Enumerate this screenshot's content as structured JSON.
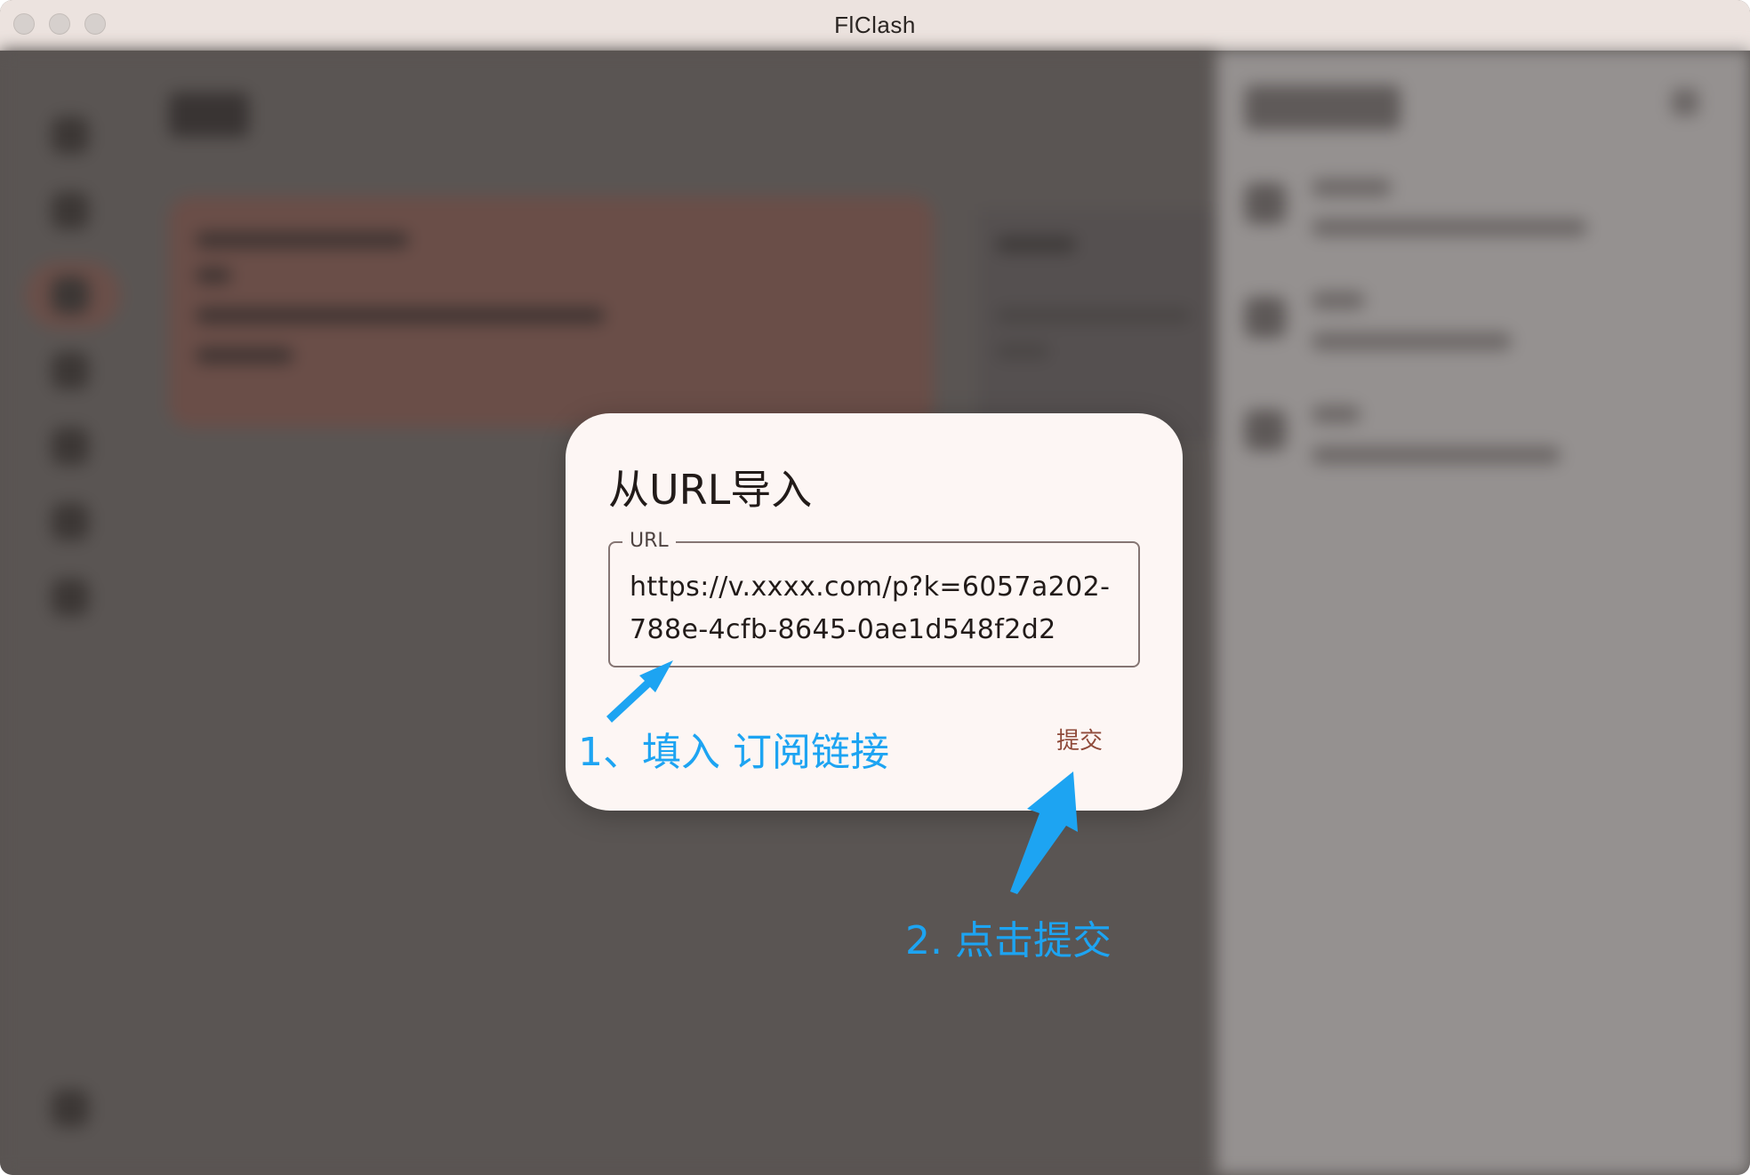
{
  "window": {
    "title": "FlClash"
  },
  "dialog": {
    "title": "从URL导入",
    "url_label": "URL",
    "url_value": "https://v.xxxx.com/p?k=6057a202-788e-4cfb-8645-0ae1d548f2d2",
    "submit_label": "提交"
  },
  "annotations": {
    "step1": "1、填入 订阅链接",
    "step2": "2. 点击提交",
    "color": "#1da4f2"
  },
  "colors": {
    "dialog_bg": "#fdf6f4",
    "submit_text": "#8f4a3a",
    "scrim": "#595452"
  }
}
